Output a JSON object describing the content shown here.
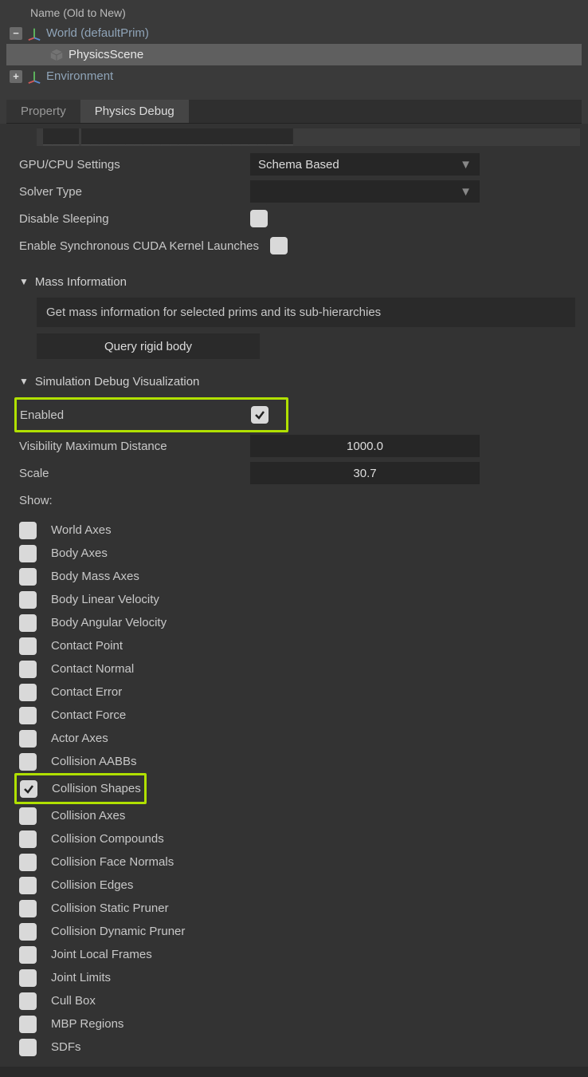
{
  "header": {
    "label": "Name (Old to New)"
  },
  "tree": {
    "node_world": {
      "label": "World (defaultPrim)",
      "exp": "−"
    },
    "node_physics": {
      "label": "PhysicsScene"
    },
    "node_env": {
      "label": "Environment",
      "exp": "+"
    }
  },
  "tabs": {
    "property": "Property",
    "physics_debug": "Physics Debug"
  },
  "truncated_row": "———  ———————————————",
  "settings": {
    "gpu_cpu_label": "GPU/CPU Settings",
    "gpu_cpu_value": "Schema Based",
    "solver_label": "Solver Type",
    "solver_value": "",
    "disable_sleep_label": "Disable Sleeping",
    "cuda_label": "Enable Synchronous CUDA Kernel Launches"
  },
  "mass": {
    "header": "Mass Information",
    "info": "Get mass information for selected prims and its sub-hierarchies",
    "btn": "Query rigid body"
  },
  "sim": {
    "header": "Simulation Debug Visualization",
    "enabled_label": "Enabled",
    "vis_max_label": "Visibility Maximum Distance",
    "vis_max_value": "1000.0",
    "scale_label": "Scale",
    "scale_value": "30.7",
    "show_label": "Show:",
    "items": [
      {
        "label": "World Axes",
        "checked": false
      },
      {
        "label": "Body Axes",
        "checked": false
      },
      {
        "label": "Body Mass Axes",
        "checked": false
      },
      {
        "label": "Body Linear Velocity",
        "checked": false
      },
      {
        "label": "Body Angular Velocity",
        "checked": false
      },
      {
        "label": "Contact Point",
        "checked": false
      },
      {
        "label": "Contact Normal",
        "checked": false
      },
      {
        "label": "Contact Error",
        "checked": false
      },
      {
        "label": "Contact Force",
        "checked": false
      },
      {
        "label": "Actor Axes",
        "checked": false
      },
      {
        "label": "Collision AABBs",
        "checked": false
      },
      {
        "label": "Collision Shapes",
        "checked": true,
        "hl": true
      },
      {
        "label": "Collision Axes",
        "checked": false
      },
      {
        "label": "Collision Compounds",
        "checked": false
      },
      {
        "label": "Collision Face Normals",
        "checked": false
      },
      {
        "label": "Collision Edges",
        "checked": false
      },
      {
        "label": "Collision Static Pruner",
        "checked": false
      },
      {
        "label": "Collision Dynamic Pruner",
        "checked": false
      },
      {
        "label": "Joint Local Frames",
        "checked": false
      },
      {
        "label": "Joint Limits",
        "checked": false
      },
      {
        "label": "Cull Box",
        "checked": false
      },
      {
        "label": "MBP Regions",
        "checked": false
      },
      {
        "label": "SDFs",
        "checked": false
      }
    ]
  }
}
